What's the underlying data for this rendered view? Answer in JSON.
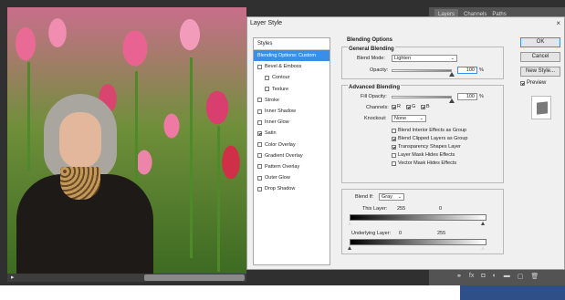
{
  "dialog": {
    "title": "Layer Style",
    "close_glyph": "×"
  },
  "styles_panel": {
    "header": "Styles",
    "items": [
      {
        "label": "Blending Options: Custom",
        "checkbox": false,
        "checked": false,
        "selected": true,
        "indent": false
      },
      {
        "label": "Bevel & Emboss",
        "checkbox": true,
        "checked": false,
        "selected": false,
        "indent": false
      },
      {
        "label": "Contour",
        "checkbox": true,
        "checked": false,
        "selected": false,
        "indent": true
      },
      {
        "label": "Texture",
        "checkbox": true,
        "checked": false,
        "selected": false,
        "indent": true
      },
      {
        "label": "Stroke",
        "checkbox": true,
        "checked": false,
        "selected": false,
        "indent": false
      },
      {
        "label": "Inner Shadow",
        "checkbox": true,
        "checked": false,
        "selected": false,
        "indent": false
      },
      {
        "label": "Inner Glow",
        "checkbox": true,
        "checked": false,
        "selected": false,
        "indent": false
      },
      {
        "label": "Satin",
        "checkbox": true,
        "checked": true,
        "selected": false,
        "indent": false
      },
      {
        "label": "Color Overlay",
        "checkbox": true,
        "checked": false,
        "selected": false,
        "indent": false
      },
      {
        "label": "Gradient Overlay",
        "checkbox": true,
        "checked": false,
        "selected": false,
        "indent": false
      },
      {
        "label": "Pattern Overlay",
        "checkbox": true,
        "checked": false,
        "selected": false,
        "indent": false
      },
      {
        "label": "Outer Glow",
        "checkbox": true,
        "checked": false,
        "selected": false,
        "indent": false
      },
      {
        "label": "Drop Shadow",
        "checkbox": true,
        "checked": false,
        "selected": false,
        "indent": false
      }
    ]
  },
  "blending": {
    "section_title": "Blending Options",
    "general": {
      "title": "General Blending",
      "blend_mode_label": "Blend Mode:",
      "blend_mode_value": "Lighten",
      "opacity_label": "Opacity:",
      "opacity_value": "100",
      "opacity_level": 1.0,
      "pct": "%"
    },
    "advanced": {
      "title": "Advanced Blending",
      "fill_opacity_label": "Fill Opacity:",
      "fill_opacity_value": "100",
      "fill_opacity_level": 1.0,
      "pct": "%",
      "channels_label": "Channels:",
      "channels": [
        {
          "label": "R",
          "checked": true
        },
        {
          "label": "G",
          "checked": true
        },
        {
          "label": "B",
          "checked": true
        }
      ],
      "knockout_label": "Knockout:",
      "knockout_value": "None",
      "options": [
        {
          "label": "Blend Interior Effects as Group",
          "checked": false
        },
        {
          "label": "Blend Clipped Layers as Group",
          "checked": true
        },
        {
          "label": "Transparency Shapes Layer",
          "checked": true
        },
        {
          "label": "Layer Mask Hides Effects",
          "checked": false
        },
        {
          "label": "Vector Mask Hides Effects",
          "checked": false
        }
      ]
    },
    "blend_if": {
      "label": "Blend If:",
      "value": "Gray",
      "this_layer_label": "This Layer:",
      "this_layer_min": "255",
      "this_layer_max": "0",
      "underlying_label": "Underlying Layer:",
      "underlying_min": "0",
      "underlying_max": "255"
    }
  },
  "buttons": {
    "ok": "OK",
    "cancel": "Cancel",
    "new_style": "New Style...",
    "preview_label": "Preview",
    "preview_checked": true
  },
  "layers_panel": {
    "tabs": [
      "Layers",
      "Channels",
      "Paths"
    ],
    "bottom_icons": [
      "link-icon",
      "fx-icon",
      "mask-icon",
      "adjustment-icon",
      "group-icon",
      "new-layer-icon",
      "trash-icon"
    ],
    "bottom_glyphs": [
      "⚭",
      "fx",
      "◘",
      "◐",
      "▬",
      "▢",
      "🗑"
    ]
  },
  "canvas": {
    "play_glyph": "▸"
  },
  "colors": {
    "accent": "#3a8ee6",
    "dialog_bg": "#f0f0f0",
    "app_bg": "#303030"
  }
}
